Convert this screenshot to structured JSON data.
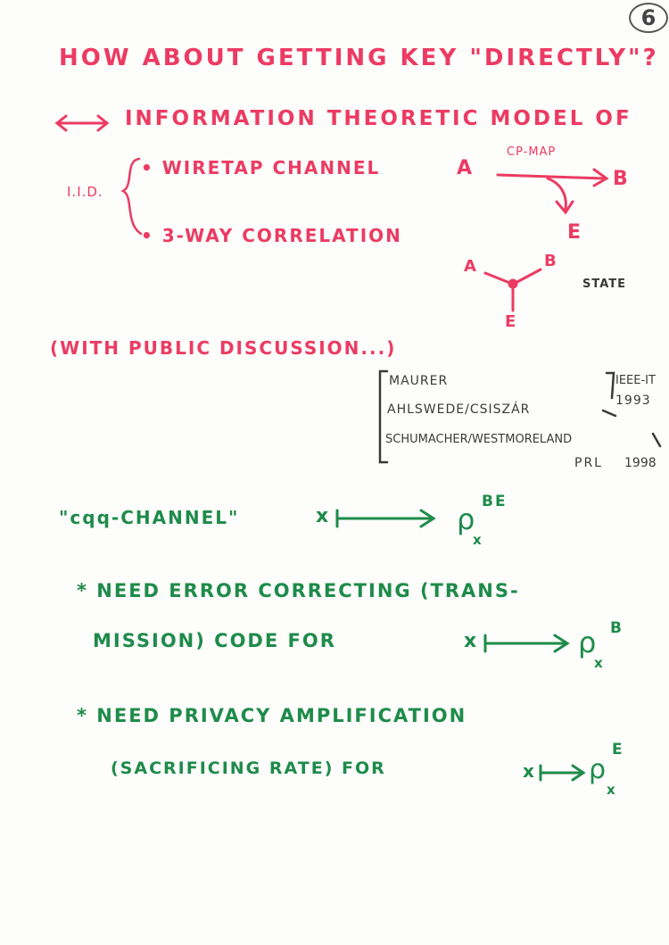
{
  "page_number": "6",
  "colors": {
    "red_ink": "#ec3b63",
    "green_ink": "#1e8b4a",
    "black_ink": "#3a3a3a"
  },
  "heading": "HOW ABOUT GETTING KEY \"DIRECTLY\"?",
  "model_line": "INFORMATION THEORETIC MODEL OF",
  "iid_label": "I.I.D.",
  "wiretap": {
    "label": "• WIRETAP CHANNEL",
    "sender": "A",
    "map_label": "CP-MAP",
    "receiver": "B",
    "eavesdropper": "E"
  },
  "correlation": {
    "label": "• 3-WAY CORRELATION",
    "node_a": "A",
    "node_b": "B",
    "node_e": "E",
    "state_label": "STATE"
  },
  "public_discussion": "(WITH PUBLIC DISCUSSION...)",
  "references": {
    "authors": [
      "MAURER",
      "AHLSWEDE/CSISZÁR",
      "SCHUMACHER/WESTMORELAND"
    ],
    "venue_1": "IEEE-IT",
    "year_1": "1993",
    "venue_2": "PRL",
    "year_2": "1998"
  },
  "cqq": {
    "label": "\"cqq-CHANNEL\"",
    "input": "x",
    "rho": "ρ",
    "subscript": "x",
    "superscript": "BE"
  },
  "item1": {
    "line1": "* NEED ERROR CORRECTING (TRANS-",
    "line2": "MISSION) CODE FOR",
    "input": "x",
    "rho": "ρ",
    "subscript": "x",
    "superscript": "B"
  },
  "item2": {
    "line1": "* NEED PRIVACY AMPLIFICATION",
    "line2": "(SACRIFICING RATE) FOR",
    "input": "x",
    "rho": "ρ",
    "subscript": "x",
    "superscript": "E"
  }
}
